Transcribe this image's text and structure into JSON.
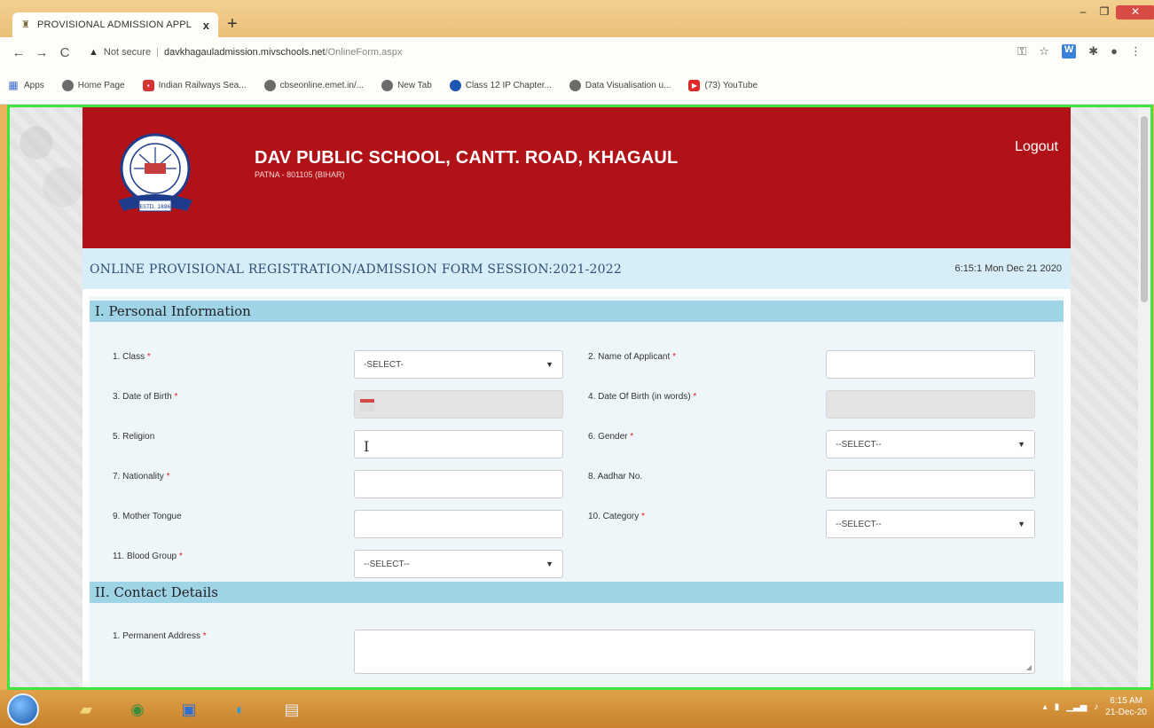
{
  "browser": {
    "tab_title": "PROVISIONAL ADMISSION APPL",
    "tab_close": "x",
    "new_tab": "+",
    "url_warning": "▲",
    "not_secure": "Not secure",
    "url_sep": "|",
    "url_host": "davkhagauladmission.mivschools.net",
    "url_path": "/OnlineForm.aspx",
    "bookmarks": [
      {
        "label": "Apps",
        "icon": "apps-grid-icon"
      },
      {
        "label": "Home Page",
        "icon": "globe-icon"
      },
      {
        "label": "Indian Railways Sea...",
        "icon": "railways-icon"
      },
      {
        "label": "cbseonline.emet.in/...",
        "icon": "globe-icon"
      },
      {
        "label": "New Tab",
        "icon": "globe-icon"
      },
      {
        "label": "Class 12 IP Chapter...",
        "icon": "dark-circle-icon"
      },
      {
        "label": "Data Visualisation u...",
        "icon": "globe-icon"
      },
      {
        "label": "(73) YouTube",
        "icon": "youtube-icon"
      }
    ]
  },
  "header": {
    "school_name": "DAV PUBLIC SCHOOL, CANTT. ROAD, KHAGAUL",
    "address": "PATNA - 801105 (BIHAR)",
    "logout": "Logout",
    "logo_estd": "ESTD. 1886"
  },
  "form": {
    "title": "ONLINE PROVISIONAL REGISTRATION/ADMISSION FORM SESSION:2021-2022",
    "timestamp": "6:15:1 Mon Dec 21 2020"
  },
  "personal": {
    "heading": "I. Personal Information",
    "class_label": "1. Class",
    "class_value": "-SELECT-",
    "name_label": "2. Name of Applicant",
    "dob_label": "3. Date of Birth",
    "dob_words_label": "4. Date Of Birth (in words)",
    "religion_label": "5. Religion",
    "gender_label": "6. Gender",
    "gender_value": "--SELECT--",
    "nationality_label": "7. Nationality",
    "aadhar_label": "8. Aadhar No.",
    "mother_tongue_label": "9. Mother Tongue",
    "category_label": "10. Category",
    "category_value": "--SELECT--",
    "blood_label": "11. Blood Group",
    "blood_value": "--SELECT--",
    "required_mark": "*"
  },
  "contact": {
    "heading": "II. Contact Details",
    "address_label": "1. Permanent Address"
  },
  "taskbar": {
    "time": "6:15 AM",
    "date": "21-Dec-20"
  },
  "colors": {
    "header_red": "#b11217",
    "section_blue": "#9fd4e7",
    "form_head_bg": "#d7eef8",
    "viewport_outline": "#3fe43f"
  }
}
